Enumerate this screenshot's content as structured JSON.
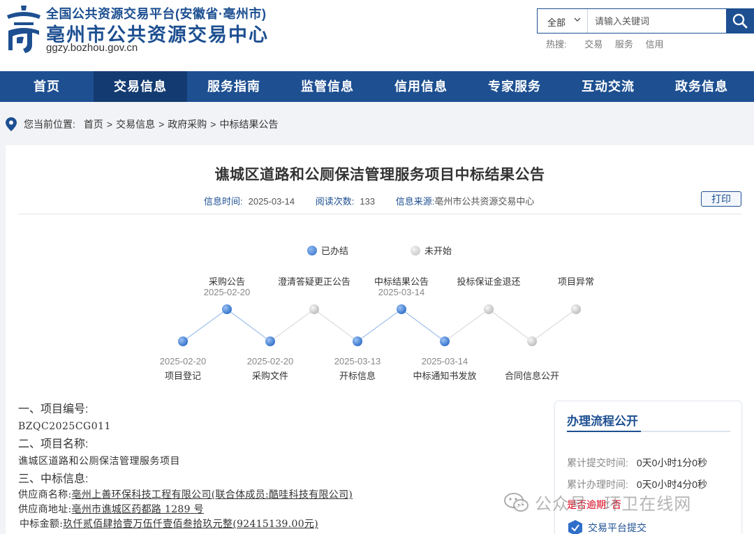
{
  "header": {
    "logo_line1": "全国公共资源交易平台(安徽省·亳州市)",
    "logo_line2": "亳州市公共资源交易中心",
    "logo_url": "ggzy.bozhou.gov.cn",
    "search": {
      "scope": "全部",
      "placeholder": "请输入关键词",
      "value": ""
    },
    "hot_label": "热搜:",
    "hot_terms": [
      "交易",
      "服务",
      "信用"
    ]
  },
  "nav": {
    "items": [
      "首页",
      "交易信息",
      "服务指南",
      "监管信息",
      "信用信息",
      "专家服务",
      "互动交流",
      "政务信息"
    ],
    "active_index": 1
  },
  "breadcrumb": {
    "prefix": "您当前位置:",
    "items": [
      "首页",
      "交易信息",
      "政府采购",
      "中标结果公告"
    ],
    "separator": ">"
  },
  "article": {
    "title": "谯城区道路和公厕保洁管理服务项目中标结果公告",
    "time_label": "信息时间:",
    "time_value": "2025-03-14",
    "reads_label": "阅读次数:",
    "reads_value": "133",
    "source_label": "信息来源:",
    "source_value": "亳州市公共资源交易中心",
    "print_label": "打印"
  },
  "legend": {
    "done": "已办结",
    "pending": "未开始"
  },
  "timeline": {
    "top": [
      {
        "label": "采购公告",
        "date": "2025-02-20",
        "done": true
      },
      {
        "label": "澄清答疑更正公告",
        "date": "",
        "done": false
      },
      {
        "label": "中标结果公告",
        "date": "2025-03-14",
        "done": true
      },
      {
        "label": "投标保证金退还",
        "date": "",
        "done": false
      },
      {
        "label": "项目异常",
        "date": "",
        "done": false
      }
    ],
    "bottom": [
      {
        "label": "项目登记",
        "date": "2025-02-20",
        "done": true
      },
      {
        "label": "采购文件",
        "date": "2025-02-20",
        "done": true
      },
      {
        "label": "开标信息",
        "date": "2025-03-13",
        "done": true
      },
      {
        "label": "中标通知书发放",
        "date": "2025-03-14",
        "done": true
      },
      {
        "label": "合同信息公开",
        "date": "",
        "done": false
      }
    ]
  },
  "content": {
    "h1": "一、项目编号:",
    "v1": "BZQC2025CG011",
    "h2": "二、项目名称:",
    "v2": "谯城区道路和公厕保洁管理服务项目",
    "h3": "三、中标信息:",
    "supplier_name_label": "供应商名称:",
    "supplier_name": "亳州上善环保科技工程有限公司(联合体成员:酷哇科技有限公司)",
    "supplier_addr_label": "供应商地址:",
    "supplier_addr": "亳州市谯城区药都路 1289 号",
    "amount_label": "中标金额:",
    "amount": "玖仟贰佰肆拾壹万伍仟壹佰叁拾玖元整(92415139.00元)"
  },
  "side": {
    "title": "办理流程公开",
    "submit_label": "累计提交时间:",
    "submit_value": "0天0小时1分0秒",
    "handle_label": "累计办理时间:",
    "handle_value": "0天0小时4分0秒",
    "overdue_label": "是否逾期:",
    "overdue_value": "否",
    "link_label": "交易平台提交"
  },
  "watermark": {
    "text": "公众号 · 环卫在线网"
  },
  "colors": {
    "brand": "#1d4f91",
    "nav_active": "#133b72",
    "done_dot": "#2f6fc9",
    "pending_dot": "#c8c8c8",
    "overdue": "#d9001b"
  }
}
